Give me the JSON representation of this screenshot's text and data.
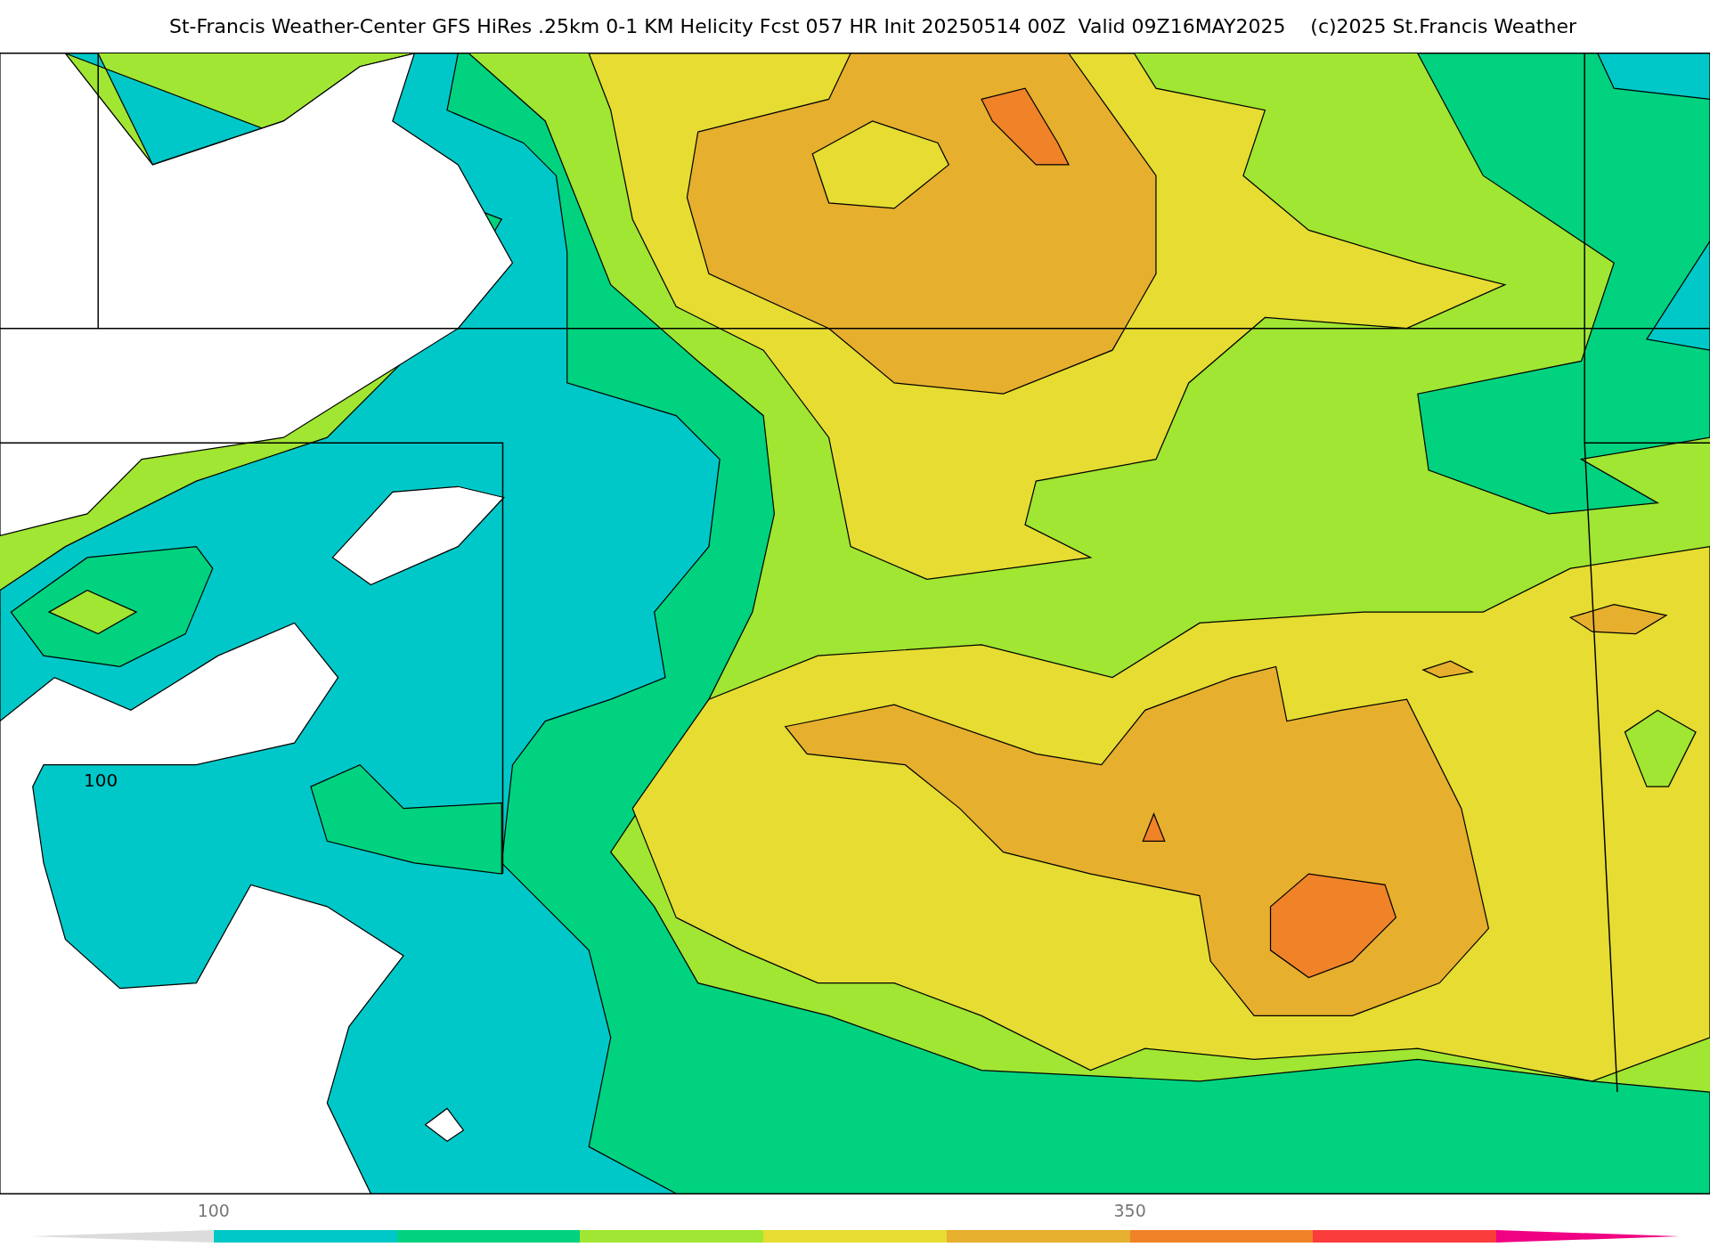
{
  "title": "St-Francis Weather-Center GFS HiRes .25km 0-1 KM Helicity Fcst 057 HR Init 20250514 00Z  Valid 09Z16MAY2025    (c)2025 St.Francis Weather",
  "map": {
    "contour_labels": [
      "100"
    ]
  },
  "colorbar": {
    "segments": [
      {
        "kind": "arrow-left",
        "color": "#dcdcdc"
      },
      {
        "kind": "band",
        "color": "#00c8c8",
        "tick_label": "100"
      },
      {
        "kind": "band",
        "color": "#00d27f"
      },
      {
        "kind": "band",
        "color": "#a0e632"
      },
      {
        "kind": "band",
        "color": "#e6dc32"
      },
      {
        "kind": "band",
        "color": "#e6af2d"
      },
      {
        "kind": "band",
        "color": "#f08228",
        "tick_label": "350"
      },
      {
        "kind": "band",
        "color": "#fa3c3c"
      },
      {
        "kind": "arrow-right",
        "color": "#f00082"
      }
    ]
  }
}
